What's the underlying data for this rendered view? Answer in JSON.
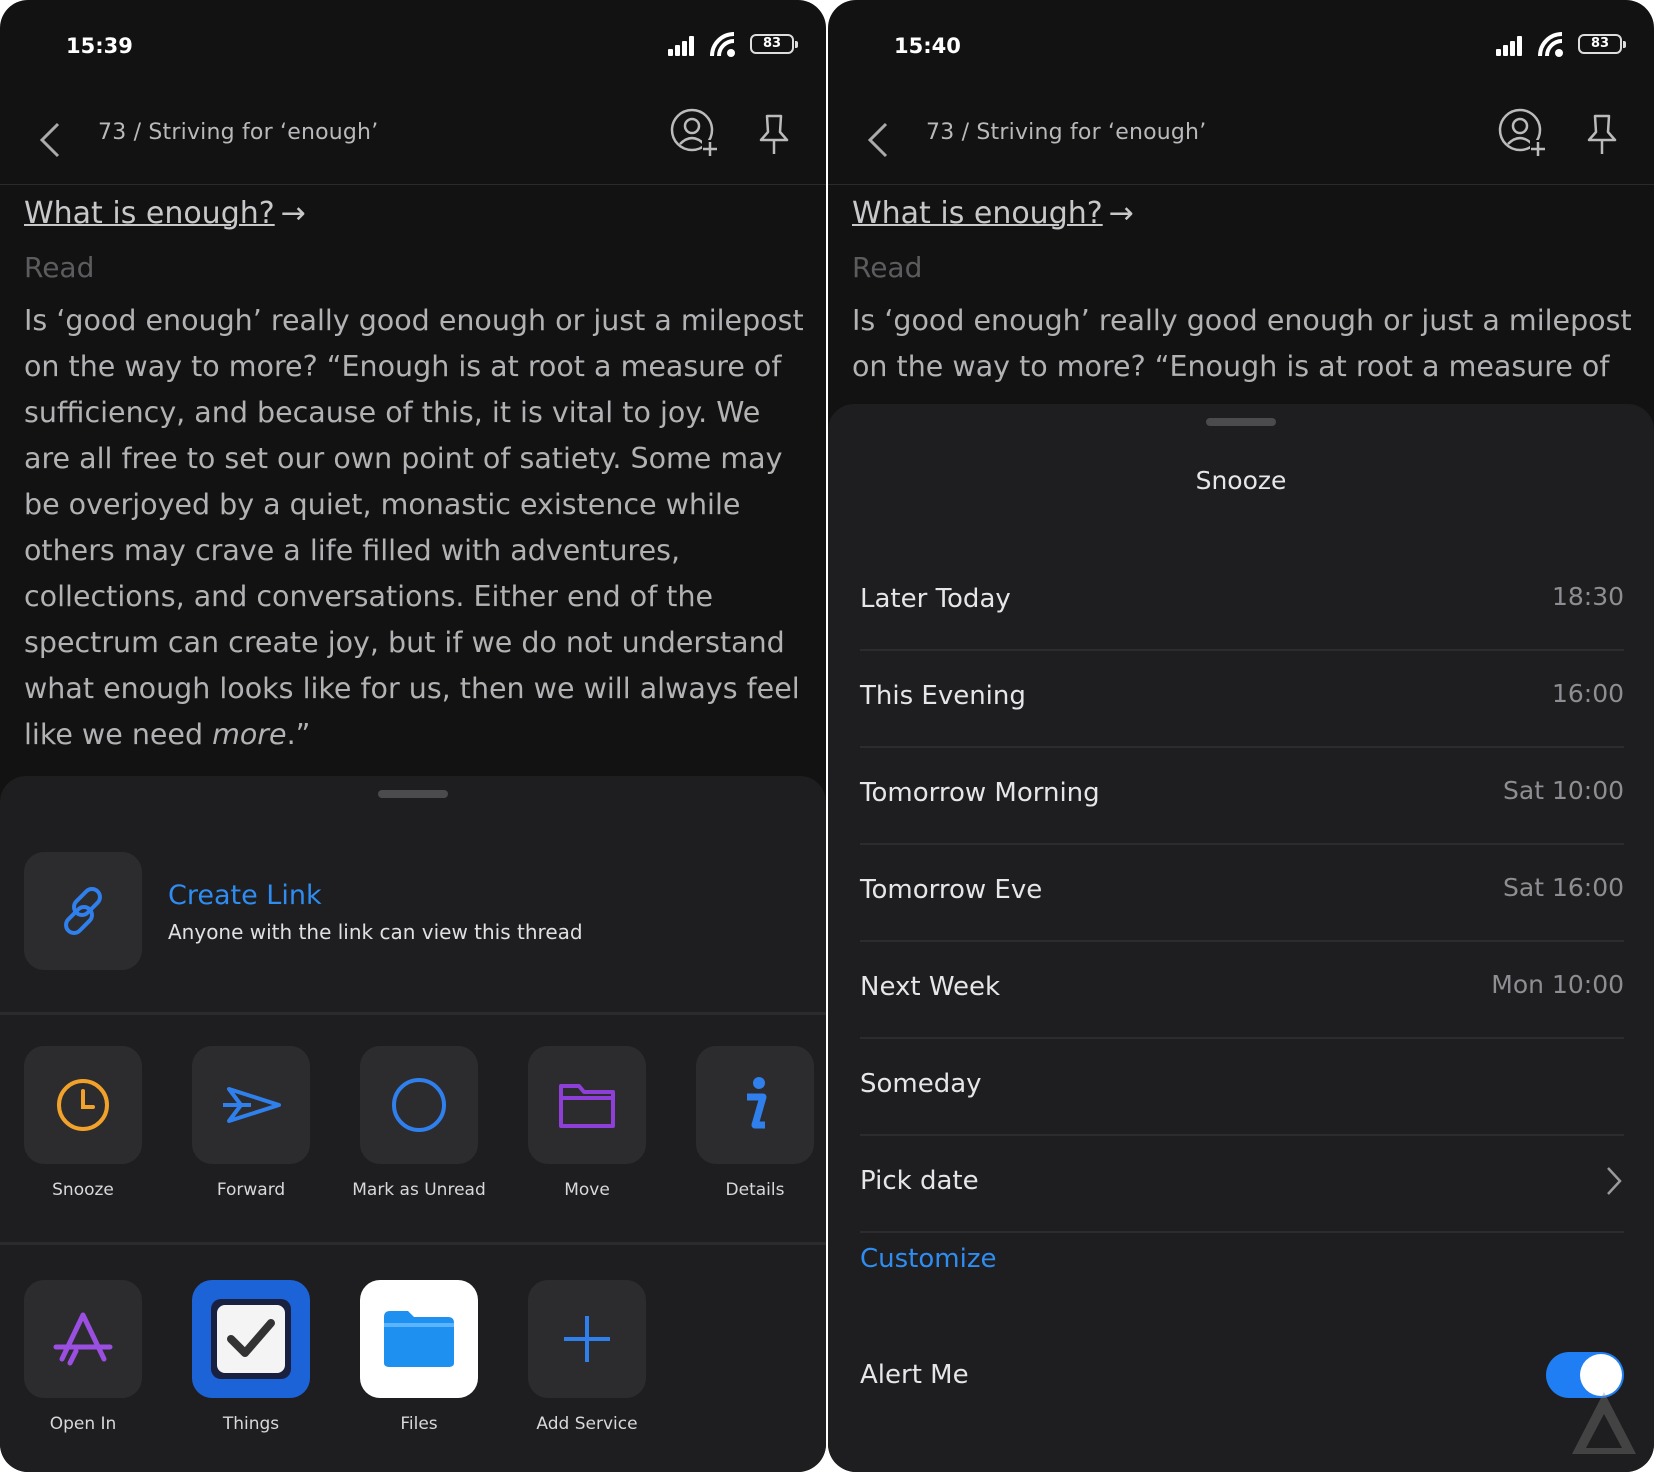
{
  "left": {
    "status": {
      "time": "15:39",
      "battery": "83"
    },
    "header": {
      "breadcrumb": "73 / Striving for ‘enough’"
    },
    "article": {
      "link": "What is enough?",
      "arrow": "→",
      "tag": "Read",
      "body_main": "Is ‘good enough’ really good enough or just a milepost on the way to more? “Enough is at root a measure of sufficiency, and because of this, it is vital to joy. We are all free to set our own point of satiety. Some may be overjoyed by a quiet, monastic existence while others may crave a life filled with adventures, collections, and conversations. Either end of the spectrum can create joy, but if we do not understand what enough looks like for us, then we will always feel like we need ",
      "body_em": "more",
      "body_end": ".”"
    },
    "sheet": {
      "create_link": {
        "title": "Create Link",
        "desc": "Anyone with the link can view this thread"
      },
      "actions": [
        {
          "label": "Snooze",
          "icon": "clock-icon",
          "color": "#f2a22a"
        },
        {
          "label": "Forward",
          "icon": "forward-icon",
          "color": "#2f80ed"
        },
        {
          "label": "Mark as Unread",
          "icon": "circle-icon",
          "color": "#2f80ed"
        },
        {
          "label": "Move",
          "icon": "folder-icon",
          "color": "#8d3fd8"
        },
        {
          "label": "Details",
          "icon": "info-icon",
          "color": "#2f80ed"
        }
      ],
      "services": [
        {
          "label": "Open In",
          "icon": "app-store-icon"
        },
        {
          "label": "Things",
          "icon": "things-icon"
        },
        {
          "label": "Files",
          "icon": "files-icon"
        },
        {
          "label": "Add Service",
          "icon": "plus-icon"
        }
      ]
    }
  },
  "right": {
    "status": {
      "time": "15:40",
      "battery": "83"
    },
    "header": {
      "breadcrumb": "73 / Striving for ‘enough’"
    },
    "article": {
      "link": "What is enough?",
      "arrow": "→",
      "tag": "Read",
      "body_main": "Is ‘good enough’ really good enough or just a milepost on the way to more? “Enough is at root a measure of"
    },
    "sheet": {
      "title": "Snooze",
      "options": [
        {
          "name": "Later Today",
          "time": "18:30"
        },
        {
          "name": "This Evening",
          "time": "16:00"
        },
        {
          "name": "Tomorrow Morning",
          "time": "Sat 10:00"
        },
        {
          "name": "Tomorrow Eve",
          "time": "Sat 16:00"
        },
        {
          "name": "Next Week",
          "time": "Mon 10:00"
        },
        {
          "name": "Someday",
          "time": ""
        },
        {
          "name": "Pick date",
          "time": ""
        }
      ],
      "customize": "Customize",
      "alert_label": "Alert Me",
      "alert_on": true
    }
  },
  "colors": {
    "accent": "#2f8cf0",
    "background": "#121213",
    "sheet": "#1e1e20"
  }
}
